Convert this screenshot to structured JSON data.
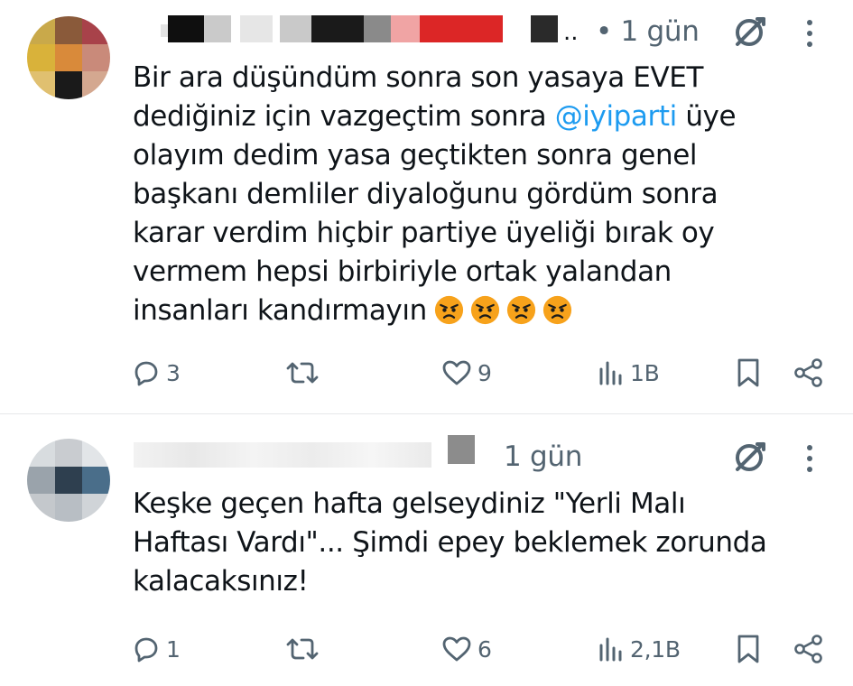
{
  "posts": [
    {
      "time_text": "• 1 gün",
      "body_before_mention": "Bir ara düşündüm sonra son yasaya EVET\ndediğiniz için vazgeçtim sonra ",
      "mention": "@iyiparti",
      "body_after_mention": " üye\nolayım dedim yasa geçtikten sonra genel\nbaşkanı demliler diyaloğunu gördüm sonra\nkarar verdim hiçbir partiye üyeliği bırak oy\nvermem hepsi birbiriyle ortak yalandan\ninsanları kandırmayın",
      "emojis": [
        "angry-face-icon",
        "angry-face-icon",
        "angry-face-icon",
        "angry-face-icon"
      ],
      "replies": "3",
      "reposts": "",
      "likes": "9",
      "views": "1B"
    },
    {
      "time_text": "1 gün",
      "body": "Keşke geçen hafta gelseydiniz \"Yerli Malı\nHaftası Vardı\"... Şimdi epey beklemek zorunda\nkalacaksınız!",
      "replies": "1",
      "reposts": "",
      "likes": "6",
      "views": "2,1B"
    }
  ],
  "icons": {
    "reply": "reply-icon",
    "repost": "repost-icon",
    "like": "heart-icon",
    "views": "views-icon",
    "bookmark": "bookmark-icon",
    "share": "share-icon",
    "grok": "grok-icon",
    "more": "more-icon"
  },
  "colors": {
    "text": "#0f1419",
    "muted": "#536471",
    "link": "#1d9bf0",
    "divider": "#e6e8ea"
  }
}
